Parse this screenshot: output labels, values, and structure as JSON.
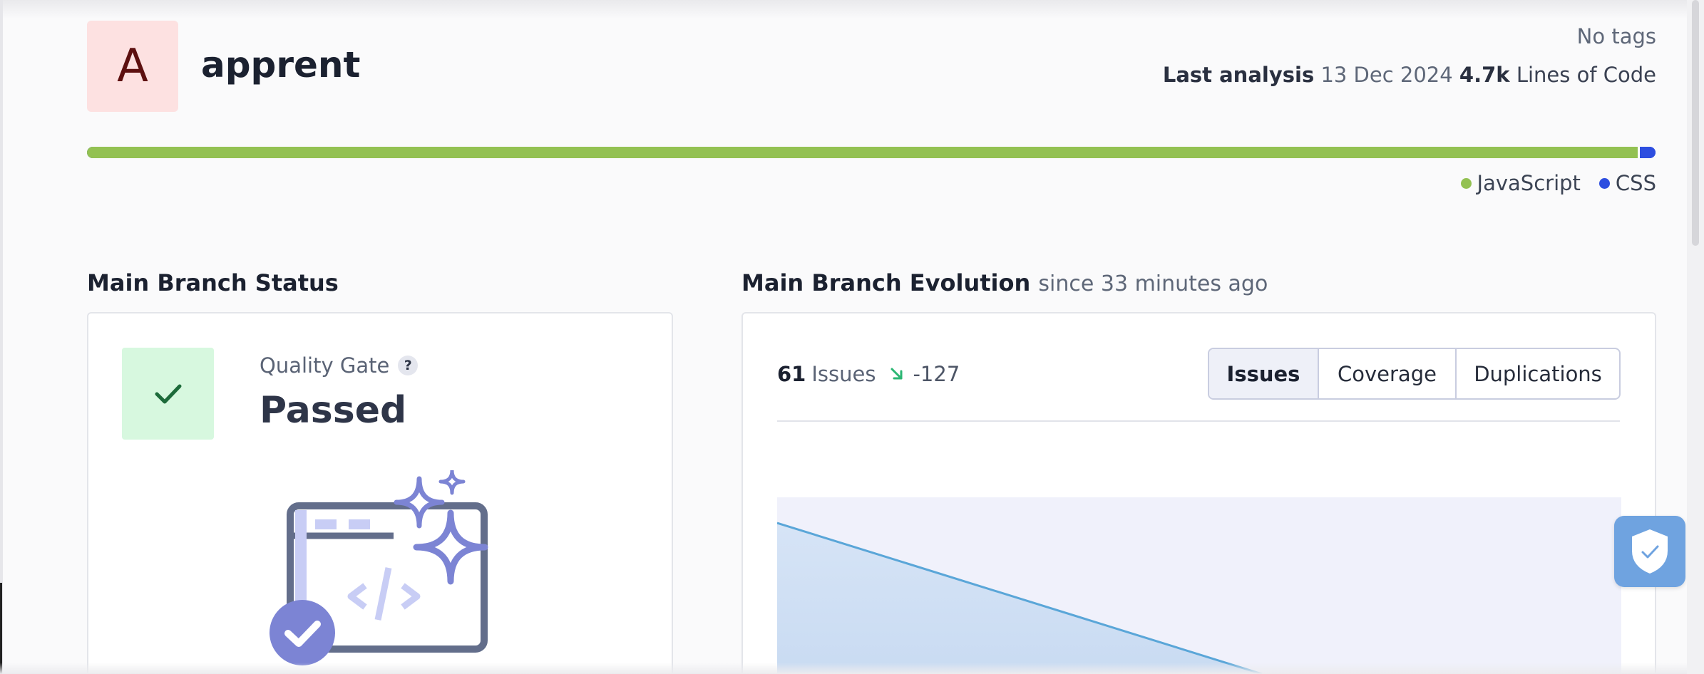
{
  "project": {
    "avatar_letter": "A",
    "name": "apprent",
    "tags": "No tags",
    "last_analysis_label": "Last analysis",
    "last_analysis_date": "13 Dec 2024",
    "loc_value": "4.7k",
    "loc_label": "Lines of Code"
  },
  "languages": {
    "items": [
      {
        "name": "JavaScript",
        "color": "#93c152",
        "share": 0.99
      },
      {
        "name": "CSS",
        "color": "#2d4ee0",
        "share": 0.01
      }
    ]
  },
  "status": {
    "title": "Main Branch Status",
    "quality_gate_label": "Quality Gate",
    "help_glyph": "?",
    "quality_gate_value": "Passed"
  },
  "evolution": {
    "title": "Main Branch Evolution",
    "since": "since 33 minutes ago",
    "issues_count": "61",
    "issues_label": "Issues",
    "delta": "-127",
    "tabs": [
      "Issues",
      "Coverage",
      "Duplications"
    ],
    "active_tab": "Issues"
  },
  "colors": {
    "accent": "#6e7fd6",
    "passed_bg": "#d7f8df",
    "passed_check": "#1d6b3a",
    "chart_line": "#5aa6d8",
    "chart_fill": "#d8e6f6",
    "chart_bg": "#f0f1fb"
  },
  "icons": [
    "check-icon",
    "help-icon",
    "trend-down-icon",
    "shield-check-icon"
  ]
}
